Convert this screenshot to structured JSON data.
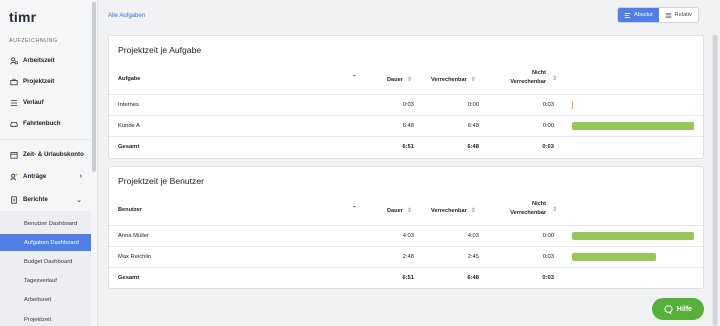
{
  "app": {
    "logo": "timr"
  },
  "sidebar": {
    "section_label": "AUFZEICHNUNG",
    "items": [
      {
        "label": "Arbeitszeit",
        "icon": "user-clock-icon"
      },
      {
        "label": "Projektzeit",
        "icon": "briefcase-icon"
      },
      {
        "label": "Verlauf",
        "icon": "list-icon"
      },
      {
        "label": "Fahrtenbuch",
        "icon": "car-icon"
      },
      {
        "label": "Zeit- & Urlaubskonto",
        "icon": "calendar-icon"
      },
      {
        "label": "Anträge",
        "icon": "request-icon"
      },
      {
        "label": "Berichte",
        "icon": "report-icon"
      }
    ],
    "sub_items": [
      {
        "label": "Benutzer Dashboard"
      },
      {
        "label": "Aufgaben Dashboard"
      },
      {
        "label": "Budget Dashboard"
      },
      {
        "label": "Tagesverlauf"
      },
      {
        "label": "Arbeitszeit"
      },
      {
        "label": "Projektzeit"
      }
    ]
  },
  "header": {
    "breadcrumb": "Alle Aufgaben",
    "toggle": {
      "absolute": "Absolut",
      "relative": "Relativ",
      "selected": "Absolut"
    }
  },
  "cards": [
    {
      "title": "Projektzeit je Aufgabe",
      "columns": {
        "name": "Aufgabe",
        "dauer": "Dauer",
        "verrechenbar": "Verrechenbar",
        "nicht_line1": "Nicht",
        "nicht_line2": "Verrechenbar"
      },
      "rows": [
        {
          "name": "Internes",
          "dauer": "0:03",
          "verrechenbar": "0:00",
          "nicht": "0:03",
          "bar_fraction": 0.0
        },
        {
          "name": "Kunde A",
          "dauer": "6:48",
          "verrechenbar": "6:48",
          "nicht": "0:00",
          "bar_fraction": 1.0
        }
      ],
      "total": {
        "name": "Gesamt",
        "dauer": "6:51",
        "verrechenbar": "6:48",
        "nicht": "0:03"
      }
    },
    {
      "title": "Projektzeit je Benutzer",
      "columns": {
        "name": "Benutzer",
        "dauer": "Dauer",
        "verrechenbar": "Verrechenbar",
        "nicht_line1": "Nicht",
        "nicht_line2": "Verrechenbar"
      },
      "rows": [
        {
          "name": "Anna Müller",
          "dauer": "4:03",
          "verrechenbar": "4:03",
          "nicht": "0:00",
          "bar_fraction": 1.0
        },
        {
          "name": "Max Reichlin",
          "dauer": "2:48",
          "verrechenbar": "2:45",
          "nicht": "0:03",
          "bar_fraction": 0.69
        }
      ],
      "total": {
        "name": "Gesamt",
        "dauer": "6:51",
        "verrechenbar": "6:48",
        "nicht": "0:03"
      }
    }
  ],
  "help_button": {
    "label": "Hilfe"
  },
  "colors": {
    "accent": "#4f7fe6",
    "bar_green": "#97c65b",
    "bar_orange": "#e89a4a",
    "help_green": "#58b03c"
  }
}
